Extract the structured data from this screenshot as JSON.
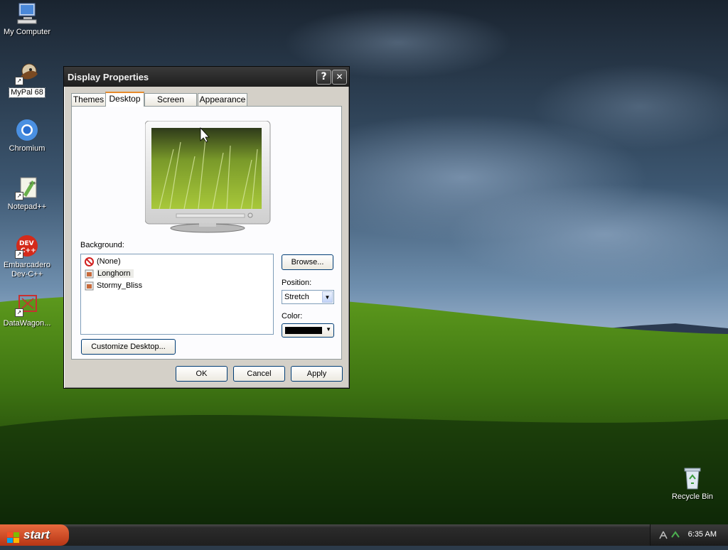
{
  "desktop": {
    "icons": [
      {
        "label": "My Computer"
      },
      {
        "label": "MyPal 68"
      },
      {
        "label": "Chromium"
      },
      {
        "label": "Notepad++"
      },
      {
        "label": "Embarcadero Dev-C++"
      },
      {
        "label": "DataWagon..."
      },
      {
        "label": "Recycle Bin"
      }
    ],
    "dev_icon_text": "DEV\nC++"
  },
  "dialog": {
    "title": "Display Properties",
    "help_glyph": "?",
    "close_glyph": "✕",
    "tabs": [
      {
        "label": "Themes"
      },
      {
        "label": "Desktop",
        "active": true
      },
      {
        "label": "Screen Saver"
      },
      {
        "label": "Appearance"
      }
    ],
    "background_label": "Background:",
    "backgrounds": [
      {
        "label": "(None)"
      },
      {
        "label": "Longhorn",
        "selected": true
      },
      {
        "label": "Stormy_Bliss"
      }
    ],
    "browse_label": "Browse...",
    "position_label": "Position:",
    "position_value": "Stretch",
    "color_label": "Color:",
    "color_value": "#000000",
    "customize_label": "Customize Desktop...",
    "ok_label": "OK",
    "cancel_label": "Cancel",
    "apply_label": "Apply"
  },
  "taskbar": {
    "start_label": "start",
    "clock": "6:35 AM"
  },
  "colors": {
    "tab_accent": "#e68b2c",
    "start_button": "#c84a25",
    "selection": "#ebebe7"
  }
}
